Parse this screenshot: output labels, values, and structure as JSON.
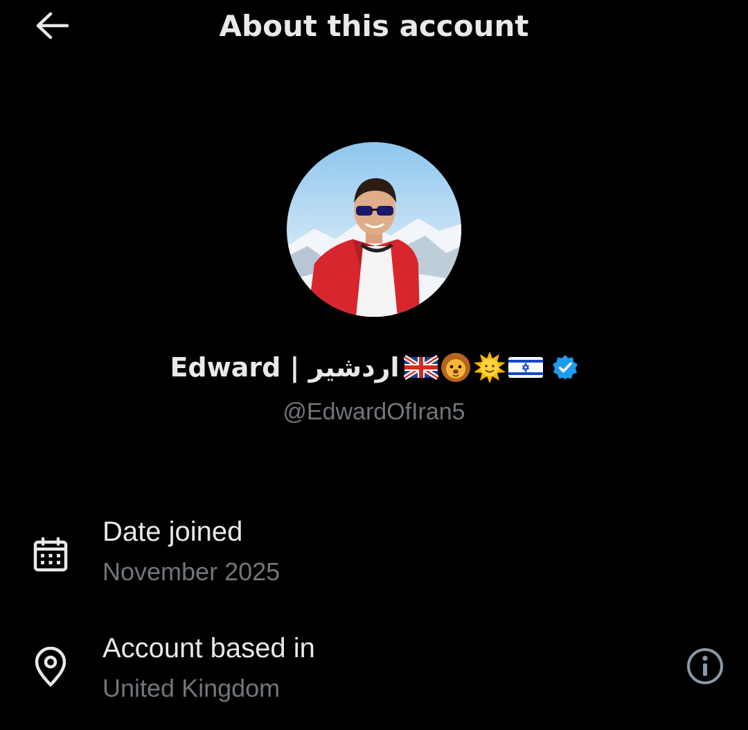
{
  "header": {
    "title": "About this account",
    "back_icon": "arrow-left-icon"
  },
  "profile": {
    "display_name": "Edward | اردشیر",
    "emojis": [
      "uk-flag-emoji",
      "lion-emoji",
      "sun-with-face-emoji",
      "israel-flag-emoji"
    ],
    "verified_icon": "verified-badge-icon",
    "handle": "@EdwardOfIran5"
  },
  "details": [
    {
      "icon": "calendar-icon",
      "label": "Date joined",
      "value": "November 2025"
    },
    {
      "icon": "location-pin-icon",
      "label": "Account based in",
      "value": "United Kingdom",
      "action_icon": "info-icon"
    }
  ],
  "colors": {
    "background": "#000000",
    "primary_text": "#e7e9ea",
    "secondary_text": "#71767b",
    "verified_blue": "#1d9bf0"
  }
}
